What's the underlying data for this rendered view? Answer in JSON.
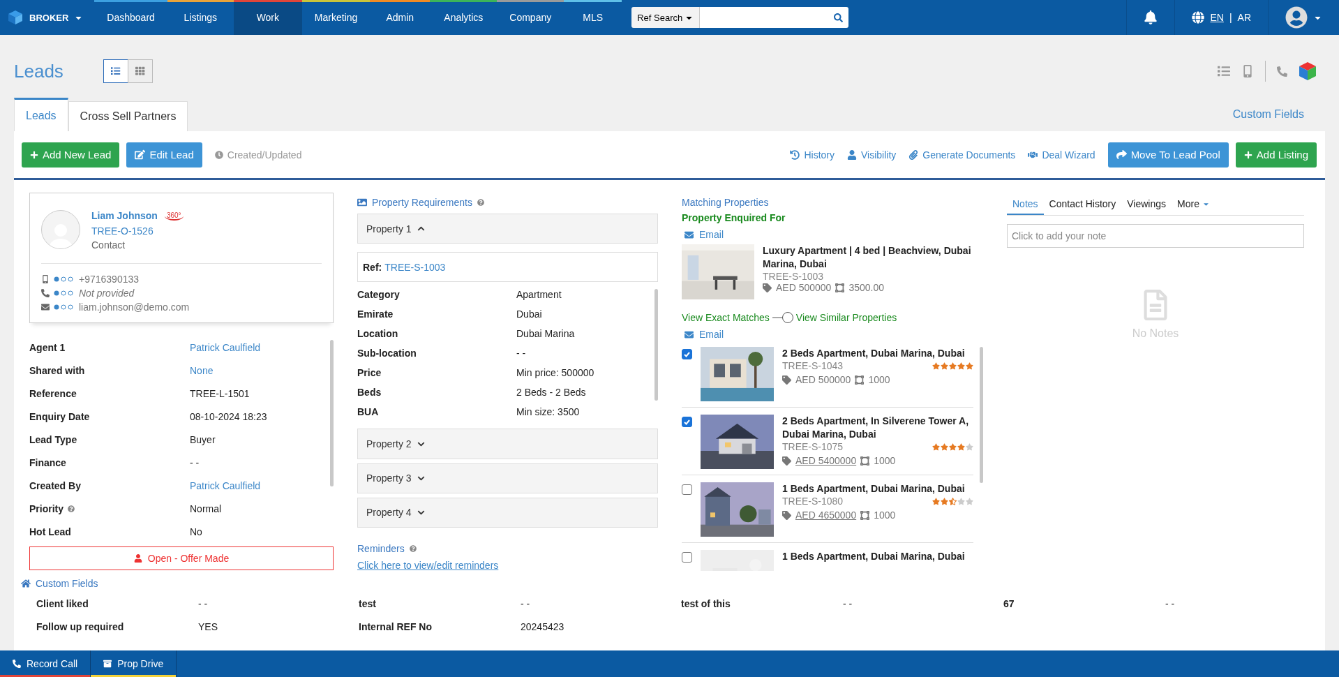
{
  "nav": {
    "brand": "BROKER",
    "items": [
      {
        "label": "Dashboard",
        "selected": false,
        "color": "#3ca0e0"
      },
      {
        "label": "Listings",
        "selected": false,
        "color": "#e8a33a"
      },
      {
        "label": "Work",
        "selected": true,
        "color": "#e0453a"
      },
      {
        "label": "Marketing",
        "selected": false,
        "color": "#c9c43a"
      },
      {
        "label": "Admin",
        "selected": false,
        "color": "#f08a24"
      },
      {
        "label": "Analytics",
        "selected": false,
        "color": "#3cb45a"
      },
      {
        "label": "Company",
        "selected": false,
        "color": "#9a9a9a"
      },
      {
        "label": "MLS",
        "selected": false,
        "color": "#5fc0e8"
      }
    ],
    "search_type": "Ref Search",
    "lang_current": "EN",
    "lang_separator": "|",
    "lang_other": "AR"
  },
  "page": {
    "title": "Leads",
    "views": [
      {
        "kind": "list",
        "selected": true
      },
      {
        "kind": "grid",
        "selected": false
      }
    ],
    "tabs": [
      {
        "label": "Leads",
        "selected": true
      },
      {
        "label": "Cross Sell Partners",
        "selected": false
      }
    ],
    "custom_fields_link": "Custom Fields"
  },
  "toolbar": {
    "add_lead": "Add New Lead",
    "edit_lead": "Edit Lead",
    "created": "Created/Updated",
    "links": [
      {
        "kind": "history",
        "label": "History"
      },
      {
        "kind": "visibility",
        "label": "Visibility"
      },
      {
        "kind": "documents",
        "label": "Generate Documents"
      },
      {
        "kind": "deal",
        "label": "Deal Wizard"
      }
    ],
    "move": "Move To Lead Pool",
    "add_listing": "Add Listing"
  },
  "contact": {
    "name": "Liam Johnson",
    "badge": "360°",
    "ref": "TREE-O-1526",
    "type": "Contact",
    "lines": [
      {
        "kind": "mobile",
        "value": "+9716390133",
        "provided": true
      },
      {
        "kind": "phone",
        "value": "Not provided",
        "provided": false
      },
      {
        "kind": "email",
        "value": "liam.johnson@demo.com",
        "provided": true
      }
    ]
  },
  "details": [
    {
      "label": "Agent 1",
      "value": "Patrick Caulfield",
      "link": true
    },
    {
      "label": "Shared with",
      "value": "None",
      "link": true
    },
    {
      "label": "Reference",
      "value": "TREE-L-1501",
      "link": false
    },
    {
      "label": "Enquiry Date",
      "value": "08-10-2024 18:23",
      "link": false
    },
    {
      "label": "Lead Type",
      "value": "Buyer",
      "link": false
    },
    {
      "label": "Finance",
      "value": "- -",
      "link": false
    },
    {
      "label": "Created By",
      "value": "Patrick Caulfield",
      "link": true
    },
    {
      "label": "Priority",
      "value": "Normal",
      "link": false,
      "help": true
    },
    {
      "label": "Hot Lead",
      "value": "No",
      "link": false
    }
  ],
  "status": "Open - Offer Made",
  "requirements": {
    "title": "Property Requirements",
    "properties": [
      {
        "label": "Property 1",
        "expanded": true,
        "ref_label": "Ref:",
        "ref": "TREE-S-1003",
        "fields": [
          {
            "label": "Category",
            "value": "Apartment"
          },
          {
            "label": "Emirate",
            "value": "Dubai"
          },
          {
            "label": "Location",
            "value": "Dubai Marina"
          },
          {
            "label": "Sub-location",
            "value": "- -"
          },
          {
            "label": "Price",
            "value": "Min price: 500000"
          },
          {
            "label": "Beds",
            "value": "2 Beds - 2 Beds"
          },
          {
            "label": "BUA",
            "value": "Min size: 3500"
          }
        ]
      },
      {
        "label": "Property 2",
        "expanded": false
      },
      {
        "label": "Property 3",
        "expanded": false
      },
      {
        "label": "Property 4",
        "expanded": false
      }
    ],
    "reminders_title": "Reminders",
    "reminders_link": "Click here to view/edit reminders"
  },
  "matching": {
    "title": "Matching Properties",
    "enquired_title": "Property Enquired For",
    "email": "Email",
    "enquired": {
      "title": "Luxury Apartment | 4 bed | Beachview, Dubai Marina, Dubai",
      "ref": "TREE-S-1003",
      "price": "AED 500000",
      "size": "3500.00"
    },
    "toggle_left": "View Exact Matches",
    "toggle_on": true,
    "toggle_right": "View Similar Properties",
    "email2": "Email",
    "items": [
      {
        "title": "2 Beds Apartment, Dubai Marina, Dubai",
        "ref": "TREE-S-1043",
        "price": "AED 500000",
        "price_differs": false,
        "size": "1000",
        "stars": 5,
        "checked": true
      },
      {
        "title": "2 Beds Apartment, In Silverene Tower A, Dubai Marina, Dubai",
        "ref": "TREE-S-1075",
        "price": "AED 5400000",
        "price_differs": true,
        "size": "1000",
        "stars": 4,
        "checked": true
      },
      {
        "title": "1 Beds Apartment, Dubai Marina, Dubai",
        "ref": "TREE-S-1080",
        "price": "AED 4650000",
        "price_differs": true,
        "size": "1000",
        "stars": 2.5,
        "checked": false
      },
      {
        "title": "1 Beds Apartment, Dubai Marina, Dubai",
        "checked": false
      }
    ]
  },
  "notes": {
    "tabs": [
      {
        "label": "Notes",
        "selected": true
      },
      {
        "label": "Contact History",
        "selected": false
      },
      {
        "label": "Viewings",
        "selected": false
      },
      {
        "label": "More",
        "selected": false
      }
    ],
    "placeholder": "Click to add your note",
    "empty": "No Notes"
  },
  "custom_fields": {
    "title": "Custom Fields",
    "rows": [
      [
        {
          "label": "Client liked",
          "value": "- -"
        },
        {
          "label": "test",
          "value": "- -"
        },
        {
          "label": "test of this",
          "value": "- -"
        },
        {
          "label": "67",
          "value": "- -"
        }
      ],
      [
        {
          "label": "Follow up required",
          "value": "YES"
        },
        {
          "label": "Internal REF No",
          "value": "20245423"
        }
      ]
    ]
  },
  "bottom_bar": [
    {
      "kind": "call",
      "label": "Record Call",
      "color": "#e0453a"
    },
    {
      "kind": "drive",
      "label": "Prop Drive",
      "color": "#f2d13a"
    }
  ]
}
